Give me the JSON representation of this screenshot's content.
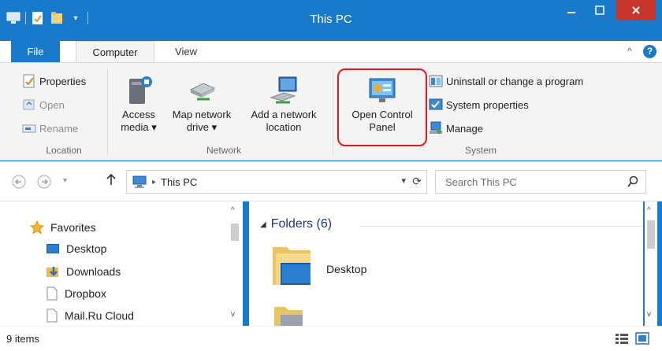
{
  "window": {
    "title": "This PC"
  },
  "tabs": [
    {
      "label": "File"
    },
    {
      "label": "Computer"
    },
    {
      "label": "View"
    }
  ],
  "ribbon": {
    "location": {
      "properties": "Properties",
      "open": "Open",
      "rename": "Rename",
      "group": "Location"
    },
    "network": {
      "access_media_line1": "Access",
      "access_media_line2": "media ▾",
      "map_drive_line1": "Map network",
      "map_drive_line2": "drive ▾",
      "add_location_line1": "Add a network",
      "add_location_line2": "location",
      "group": "Network"
    },
    "system": {
      "open_cp_line1": "Open Control",
      "open_cp_line2": "Panel",
      "uninstall": "Uninstall or change a program",
      "system_properties": "System properties",
      "manage": "Manage",
      "group": "System"
    }
  },
  "address": {
    "path": "This PC"
  },
  "search": {
    "placeholder": "Search This PC"
  },
  "nav_pane": {
    "favorites": "Favorites",
    "items": [
      "Desktop",
      "Downloads",
      "Dropbox",
      "Mail.Ru Cloud"
    ]
  },
  "content": {
    "section": "Folders (6)",
    "folders": [
      "Desktop"
    ]
  },
  "status": {
    "item_count": "9 items"
  },
  "colors": {
    "accent": "#1979ca",
    "highlight": "#e21a1a",
    "section_header": "#1e3287"
  }
}
